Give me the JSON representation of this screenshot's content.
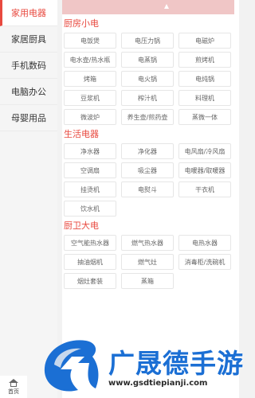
{
  "sidebar": {
    "items": [
      {
        "label": "家用电器",
        "active": true
      },
      {
        "label": "家居厨具",
        "active": false
      },
      {
        "label": "手机数码",
        "active": false
      },
      {
        "label": "电脑办公",
        "active": false
      },
      {
        "label": "母婴用品",
        "active": false
      }
    ]
  },
  "sections": [
    {
      "title": "厨房小电",
      "items": [
        "电饭煲",
        "电压力锅",
        "电磁炉",
        "电水壶/热水瓶",
        "电蒸锅",
        "煎烤机",
        "烤箱",
        "电火锅",
        "电炖锅",
        "豆浆机",
        "榨汁机",
        "料理机",
        "微波炉",
        "养生壶/煎药壶",
        "蒸微一体"
      ]
    },
    {
      "title": "生活电器",
      "items": [
        "净水器",
        "净化器",
        "电风扇/冷风扇",
        "空调扇",
        "吸尘器",
        "电暖器/取暖器",
        "挂烫机",
        "电熨斗",
        "干衣机",
        "饮水机"
      ]
    },
    {
      "title": "厨卫大电",
      "items": [
        "空气能热水器",
        "燃气热水器",
        "电热水器",
        "抽油烟机",
        "燃气灶",
        "消毒柜/洗碗机",
        "烟灶套装",
        "蒸箱"
      ]
    }
  ],
  "bottom_nav": {
    "home_label": "首页"
  },
  "watermark": {
    "title": "广晟德手游",
    "url": "www.gsdtiepianji.com"
  },
  "colors": {
    "accent": "#e8493f",
    "banner": "#f0c6c6",
    "watermark_blue": "#1b6fd4"
  }
}
